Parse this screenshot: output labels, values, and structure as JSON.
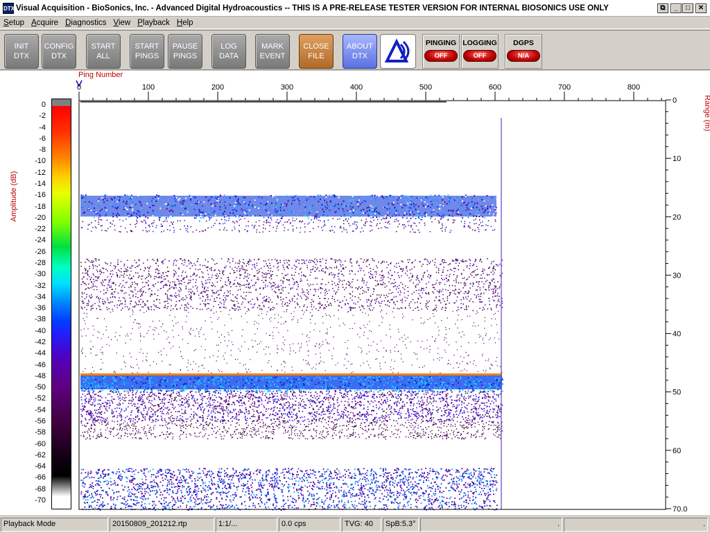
{
  "window": {
    "icon_text": "DTX",
    "title": "Visual Acquisition  -  BioSonics, Inc.  -  Advanced Digital Hydroacoustics  -- THIS IS A PRE-RELEASE TESTER VERSION FOR INTERNAL BIOSONICS USE ONLY",
    "buttons": [
      "⧉",
      "_",
      "□",
      "✕"
    ]
  },
  "menu": [
    {
      "first": "S",
      "rest": "etup"
    },
    {
      "first": "A",
      "rest": "cquire"
    },
    {
      "first": "D",
      "rest": "iagnostics"
    },
    {
      "first": "V",
      "rest": "iew"
    },
    {
      "first": "P",
      "rest": "layback"
    },
    {
      "first": "H",
      "rest": "elp"
    }
  ],
  "toolbar": {
    "init": "INIT\nDTX",
    "config": "CONFIG\nDTX",
    "start_all": "START\nALL",
    "start_pings": "START\nPINGS",
    "pause_pings": "PAUSE\nPINGS",
    "log_data": "LOG\nDATA",
    "mark_event": "MARK\nEVENT",
    "close_file": "CLOSE\nFILE",
    "about_dtx": "ABOUT\nDTX",
    "pinging": {
      "label": "PINGING",
      "state": "OFF"
    },
    "logging": {
      "label": "LOGGING",
      "state": "OFF"
    },
    "dgps": {
      "label": "DGPS",
      "state": "N/A"
    }
  },
  "echogram": {
    "ping_axis_label": "Ping Number",
    "amplitude_label": "Amplitude (dB)",
    "range_label": "Range (m)",
    "ping_ticks": [
      "0",
      "100",
      "200",
      "300",
      "400",
      "500",
      "600",
      "700",
      "800"
    ],
    "range_ticks": [
      "0",
      "10",
      "20",
      "30",
      "40",
      "50",
      "60",
      "70.0"
    ],
    "amp_ticks": [
      "0",
      "-2",
      "-4",
      "-6",
      "-8",
      "-10",
      "-12",
      "-14",
      "-16",
      "-18",
      "-20",
      "-22",
      "-24",
      "-26",
      "-28",
      "-30",
      "-32",
      "-34",
      "-36",
      "-38",
      "-40",
      "-42",
      "-44",
      "-46",
      "-48",
      "-50",
      "-52",
      "-54",
      "-56",
      "-58",
      "-60",
      "-62",
      "-64",
      "-66",
      "-68",
      "-70"
    ]
  },
  "status": {
    "mode": "Playback Mode",
    "file": "20150809_201212.rtp",
    "ratio": "1:1/...",
    "cps": "0.0 cps",
    "tvg": "TVG: 40",
    "spb": "SpB:5.3°",
    "blank1": "",
    "dot1": ".",
    "dot2": "."
  }
}
